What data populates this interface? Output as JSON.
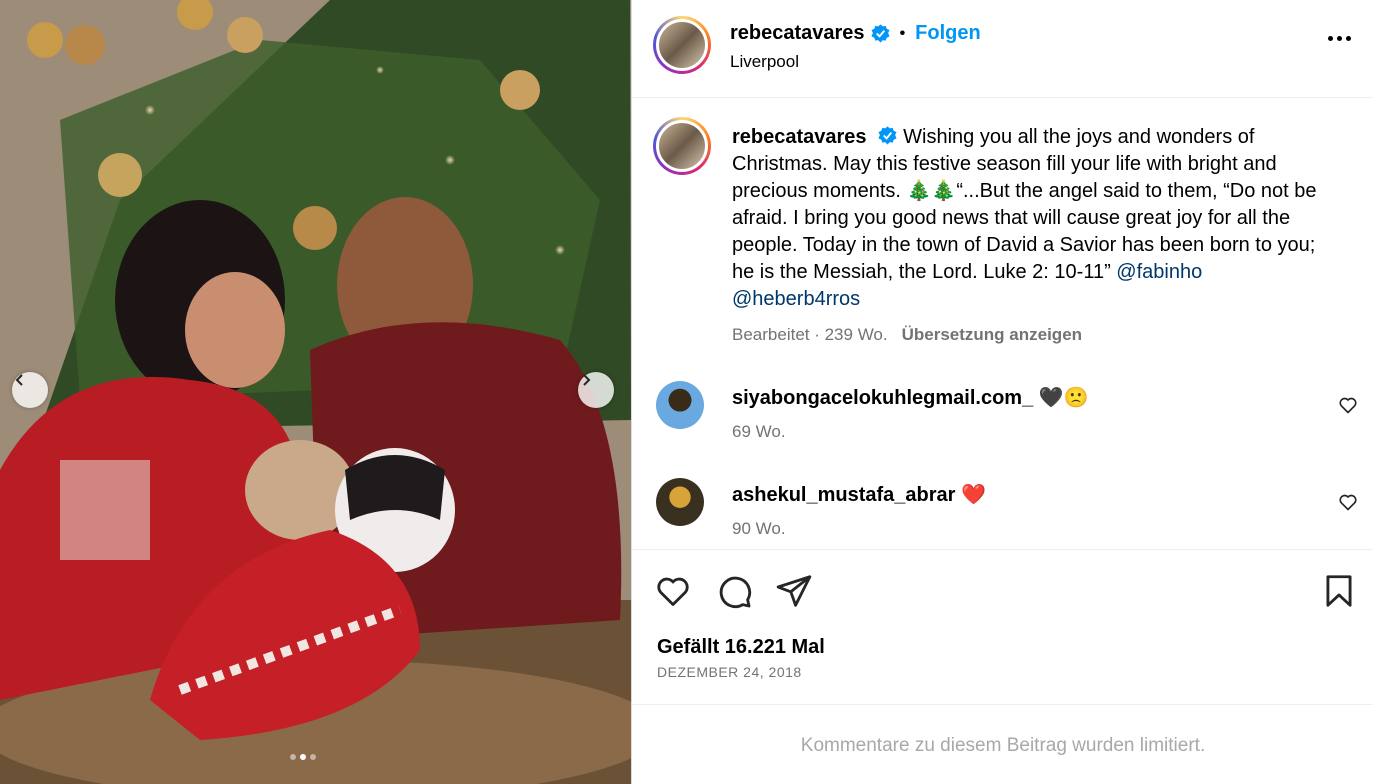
{
  "post": {
    "username": "rebecatavares",
    "follow_label": "Folgen",
    "separator": "•",
    "location": "Liverpool",
    "photo_alt": "Paar in roten Weihnachtspullovern mit zwei französischen Bulldoggen vor einem Weihnachtsbaum"
  },
  "caption": {
    "username": "rebecatavares",
    "text": "Wishing you all the joys and wonders of Christmas. May this festive season fill your life with bright and precious moments. 🎄🎄“...But the angel said to them, “Do not be afraid. I bring you good news that will cause great joy for all the people. Today in the town of David a Savior has been born to you; he is the Messiah, the Lord. Luke 2: 10-11” ",
    "mention1": "@fabinho",
    "mention2": "@heberb4rros",
    "meta": "Bearbeitet · 239 Wo.",
    "translate_label": "Übersetzung anzeigen"
  },
  "comments": [
    {
      "username": "siyabongacelokuhlegmail.com_",
      "text": "🖤🙁",
      "time": "69 Wo."
    },
    {
      "username": "ashekul_mustafa_abrar",
      "text": "❤️",
      "time": "90 Wo."
    }
  ],
  "engagement": {
    "likes": "Gefällt 16.221 Mal",
    "date": "DEZEMBER 24, 2018"
  },
  "footer": {
    "comments_limited": "Kommentare zu diesem Beitrag wurden limitiert."
  },
  "icons": {
    "like": "heart-icon",
    "comment": "comment-icon",
    "share": "share-icon",
    "save": "bookmark-icon",
    "verified": "verified-badge-icon"
  },
  "colors": {
    "link": "#0095f6",
    "mention": "#00376b",
    "meta": "#737373",
    "verified": "#0095f6"
  },
  "carousel": {
    "slides": 3,
    "active": 2
  }
}
